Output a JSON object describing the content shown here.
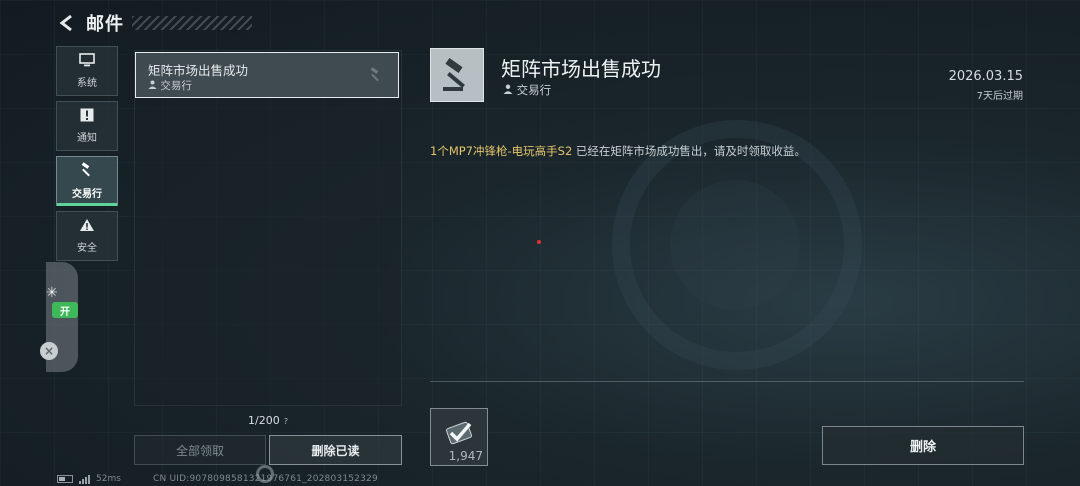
{
  "header": {
    "back_icon": "chevron-left-icon",
    "title": "邮件"
  },
  "sidebar": {
    "tabs": [
      {
        "label": "系统",
        "icon": "monitor-icon",
        "active": false
      },
      {
        "label": "通知",
        "icon": "alert-box-icon",
        "active": false
      },
      {
        "label": "交易行",
        "icon": "gavel-icon",
        "active": true
      },
      {
        "label": "安全",
        "icon": "warning-triangle-icon",
        "active": false
      }
    ]
  },
  "float_widget": {
    "badge": "开"
  },
  "mail_list": {
    "items": [
      {
        "title": "矩阵市场出售成功",
        "sender": "交易行"
      }
    ],
    "count": "1/200",
    "count_hint": "?",
    "claim_all_label": "全部领取",
    "delete_read_label": "删除已读"
  },
  "detail": {
    "icon": "gavel-icon",
    "title": "矩阵市场出售成功",
    "sender": "交易行",
    "date": "2026.03.15",
    "expire": "7天后过期",
    "body_highlight": "1个MP7冲锋枪-电玩高手S2",
    "body_rest": " 已经在矩阵市场成功售出，请及时领取收益。",
    "attachment": {
      "icon": "coin-check-icon",
      "count": "1,947"
    },
    "delete_label": "删除"
  },
  "status": {
    "latency": "52ms",
    "uid": "CN UID:9078098581321976761_202803152329"
  },
  "colors": {
    "accent_green": "#5fd49a",
    "highlight_gold": "#e2c46a",
    "badge_green": "#3fb85a"
  }
}
